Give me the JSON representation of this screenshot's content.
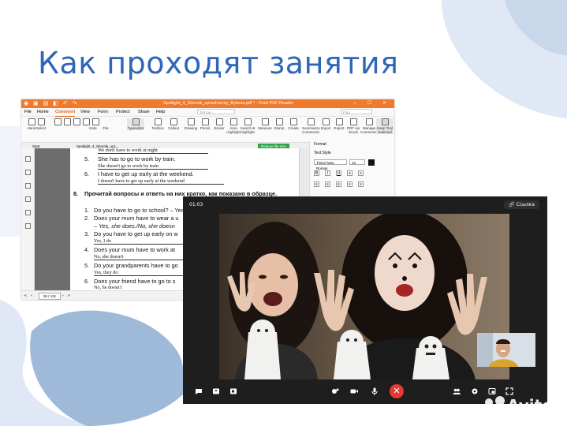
{
  "slide": {
    "title": "Как проходят занятия",
    "colors": {
      "title": "#2f66b8",
      "blob_light": "#dfe8f4",
      "blob_mid": "#9fb9d9"
    }
  },
  "pdf_window": {
    "title": "Spotlight_4_Sbornik_uprazhneniy_Bykova.pdf * - Foxit PDF Reader",
    "menu": [
      "File",
      "Home",
      "Comment",
      "View",
      "Form",
      "Protect",
      "Share",
      "Help"
    ],
    "active_menu": "Comment",
    "search_placeholder": "Tell me...",
    "find_placeholder": "Find",
    "tools": [
      "Hand",
      "Select",
      "Highlight",
      "Underline",
      "Strikeout",
      "Replace",
      "Insert",
      "Typewriter",
      "Note",
      "File",
      "Typewriter",
      "Textbox",
      "Callout",
      "Drawing",
      "Pencil",
      "Eraser",
      "Area Highlight",
      "Search & Highlight",
      "Measure",
      "Stamp",
      "Create",
      "Summarize Comments",
      "Import",
      "Export",
      "PDF via Email",
      "Manage Comments",
      "Keep Tool Selected"
    ],
    "tabs": {
      "start": "Start",
      "doc": "Spotlight_4_Sbornik_upr...",
      "reduce": "Reduce file size"
    },
    "format_panel": {
      "tab": "Format",
      "section": "Text Style",
      "font": "Times New Roman",
      "size": "12",
      "color": "#111111"
    },
    "page": {
      "lines": [
        {
          "n": "",
          "text": "We don't have to work at night",
          "hand": true
        },
        {
          "n": "5.",
          "text": "She has to go to work by train."
        },
        {
          "n": "",
          "text": "She doesn't go to work by train",
          "hand": true
        },
        {
          "n": "6.",
          "text": "I have to get up early at the weekend."
        },
        {
          "n": "",
          "text": "I doesn't have to get up early at the weekend",
          "hand": true
        }
      ],
      "section": {
        "n": "8.",
        "heading": "Прочитай вопросы и ответь на них кратко, как показано в образце.",
        "questions": [
          {
            "n": "1.",
            "q": "Do you have to go to school? – Yes"
          },
          {
            "n": "2.",
            "q": "Does your mum have to wear a u"
          },
          {
            "n": "",
            "q": "– Yes, she does./No, she doesn"
          },
          {
            "n": "3.",
            "q": "Do you have to get up early on w"
          },
          {
            "n": "",
            "q": "Yes, I do",
            "hand": true
          },
          {
            "n": "4.",
            "q": "Does your mum have to work at"
          },
          {
            "n": "",
            "q": "No, she doesn't",
            "hand": true
          },
          {
            "n": "5.",
            "q": "Do your grandparents have to go"
          },
          {
            "n": "",
            "q": "Yes, they do",
            "hand": true
          },
          {
            "n": "6.",
            "q": "Does your friend have to go to s"
          },
          {
            "n": "",
            "q": "No, he doesn't",
            "hand": true
          }
        ]
      }
    },
    "status": {
      "page": "26 / 131"
    }
  },
  "call": {
    "timer": "01:03",
    "link_label": "Ссылка",
    "colors": {
      "bg": "#1e1e1e",
      "hangup": "#e53935"
    },
    "controls": [
      "chat-icon",
      "screen-share-icon",
      "record-icon",
      "effects-icon",
      "camera-icon",
      "microphone-icon",
      "hangup-icon",
      "participants-icon",
      "settings-icon",
      "layout-icon",
      "fullscreen-icon"
    ]
  },
  "watermark": {
    "text": "Avito"
  }
}
